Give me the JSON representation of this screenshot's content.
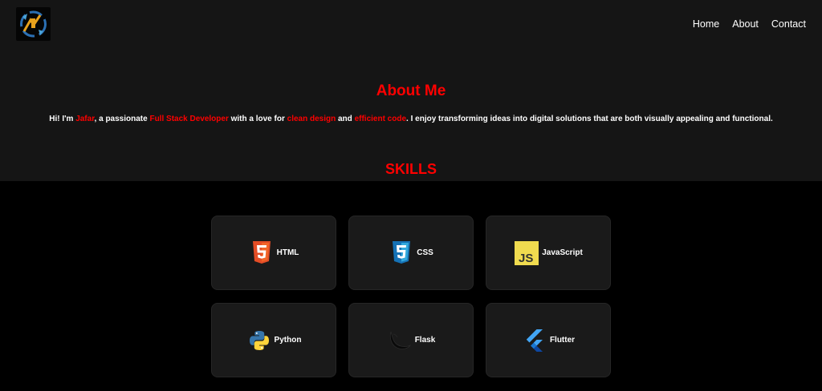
{
  "nav": {
    "items": [
      "Home",
      "About",
      "Contact"
    ]
  },
  "about": {
    "title": "About Me",
    "intro_1": "Hi! I'm ",
    "name": "Jafar",
    "intro_2": ", a passionate ",
    "role": "Full Stack Developer",
    "intro_3": " with a love for ",
    "quality_1": "clean design",
    "intro_4": " and ",
    "quality_2": "efficient code",
    "intro_5": ". I enjoy transforming ideas into digital solutions that are both visually appealing and functional."
  },
  "skills": {
    "title": "SKILLS",
    "items": [
      {
        "label": "HTML",
        "icon": "html5-icon"
      },
      {
        "label": "CSS",
        "icon": "css3-icon"
      },
      {
        "label": "JavaScript",
        "icon": "javascript-icon"
      },
      {
        "label": "Python",
        "icon": "python-icon"
      },
      {
        "label": "Flask",
        "icon": "flask-icon"
      },
      {
        "label": "Flutter",
        "icon": "flutter-icon"
      }
    ]
  },
  "colors": {
    "accent": "#ff0000",
    "header_bg": "#151515",
    "page_bg": "#000000",
    "card_bg": "#1a1a1a"
  }
}
